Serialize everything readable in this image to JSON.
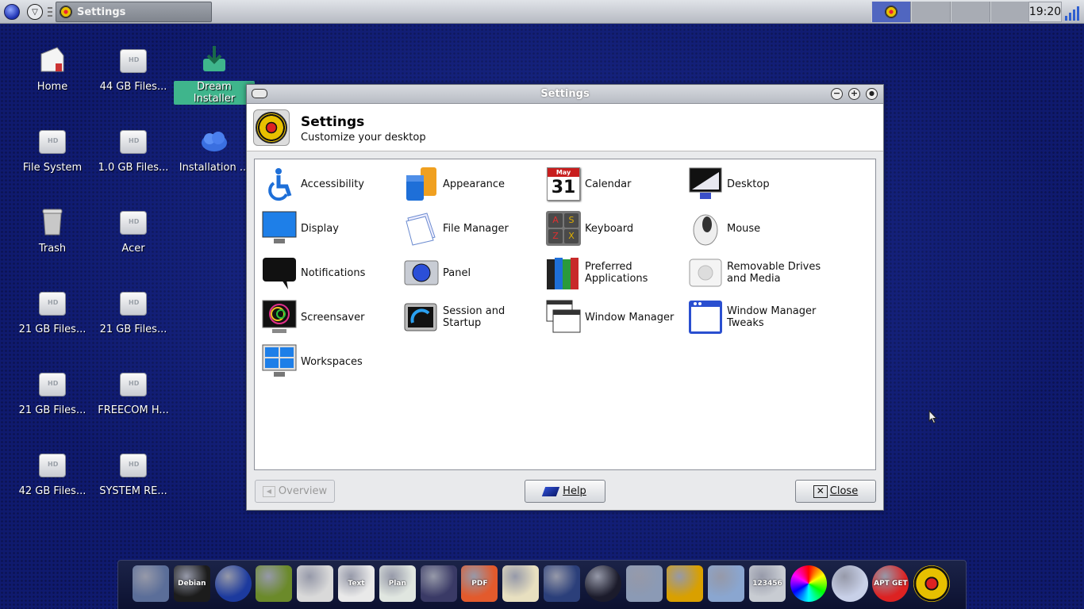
{
  "top_panel": {
    "task_title": "Settings",
    "clock": "19:20"
  },
  "desktop": {
    "icons": [
      {
        "label": "Home",
        "kind": "home"
      },
      {
        "label": "44 GB Files...",
        "kind": "drive"
      },
      {
        "label": "Dream Installer",
        "kind": "installer"
      },
      {
        "label": "File System",
        "kind": "drive"
      },
      {
        "label": "1.0 GB Files...",
        "kind": "drive"
      },
      {
        "label": "Installation ...",
        "kind": "cloud"
      },
      {
        "label": "Trash",
        "kind": "trash"
      },
      {
        "label": "Acer",
        "kind": "drive"
      },
      {
        "label": "21 GB Files...",
        "kind": "drive"
      },
      {
        "label": "21 GB Files...",
        "kind": "drive"
      },
      {
        "label": "21 GB Files...",
        "kind": "drive"
      },
      {
        "label": "FREECOM H...",
        "kind": "drive"
      },
      {
        "label": "42 GB Files...",
        "kind": "drive"
      },
      {
        "label": "SYSTEM RE...",
        "kind": "drive"
      }
    ]
  },
  "window": {
    "title": "Settings",
    "header_title": "Settings",
    "header_subtitle": "Customize your desktop",
    "items": [
      {
        "label": "Accessibility",
        "icon": "accessibility-icon"
      },
      {
        "label": "Appearance",
        "icon": "appearance-icon"
      },
      {
        "label": "Calendar",
        "icon": "calendar-icon",
        "icon_text_month": "May",
        "icon_text_day": "31"
      },
      {
        "label": "Desktop",
        "icon": "desktop-icon"
      },
      {
        "label": "Display",
        "icon": "display-icon"
      },
      {
        "label": "File Manager",
        "icon": "file-manager-icon"
      },
      {
        "label": "Keyboard",
        "icon": "keyboard-icon",
        "icon_keys": [
          "A",
          "S",
          "Z",
          "X"
        ]
      },
      {
        "label": "Mouse",
        "icon": "mouse-icon"
      },
      {
        "label": "Notifications",
        "icon": "notifications-icon"
      },
      {
        "label": "Panel",
        "icon": "panel-icon"
      },
      {
        "label": "Preferred Applications",
        "icon": "preferred-apps-icon"
      },
      {
        "label": "Removable Drives and Media",
        "icon": "removable-drives-icon"
      },
      {
        "label": "Screensaver",
        "icon": "screensaver-icon"
      },
      {
        "label": "Session and Startup",
        "icon": "session-icon"
      },
      {
        "label": "Window Manager",
        "icon": "window-manager-icon"
      },
      {
        "label": "Window Manager Tweaks",
        "icon": "wm-tweaks-icon"
      },
      {
        "label": "Workspaces",
        "icon": "workspaces-icon"
      }
    ],
    "buttons": {
      "overview": "Overview",
      "help": "Help",
      "close": "Close"
    }
  },
  "dock": {
    "items": [
      "media-player",
      "terminal",
      "web-browser",
      "mail",
      "text-editor",
      "word-processor",
      "spreadsheet",
      "presentation",
      "pdf-viewer",
      "image-editor",
      "scanner",
      "webcam",
      "disk-burner",
      "film",
      "volume",
      "calculator",
      "color-picker",
      "dvd-player",
      "apt-get",
      "settings"
    ],
    "icon_texts": {
      "terminal": "Debian",
      "word-processor": "Text",
      "spreadsheet": "Plan",
      "pdf-viewer": "PDF",
      "calculator": "123456",
      "apt-get": "APT GET"
    },
    "colors": {
      "media-player": "#5b6e99",
      "terminal": "#1c1c1c",
      "web-browser": "#1c3a9e",
      "mail": "#6b8a2a",
      "text-editor": "#d9d9d9",
      "word-processor": "#e9e9e9",
      "spreadsheet": "#e0e6e0",
      "presentation": "#3a3a66",
      "pdf-viewer": "#e35a2c",
      "image-editor": "#e8e0c0",
      "scanner": "#2b3f7a",
      "webcam": "#1b1b2b",
      "disk-burner": "#8b9ab5",
      "film": "#d9a000",
      "volume": "#8aa6d0",
      "calculator": "#c8ccd2",
      "color-picker": "#222",
      "dvd-player": "#c8d0e8",
      "apt-get": "#d22",
      "settings": "#e7c000"
    }
  }
}
